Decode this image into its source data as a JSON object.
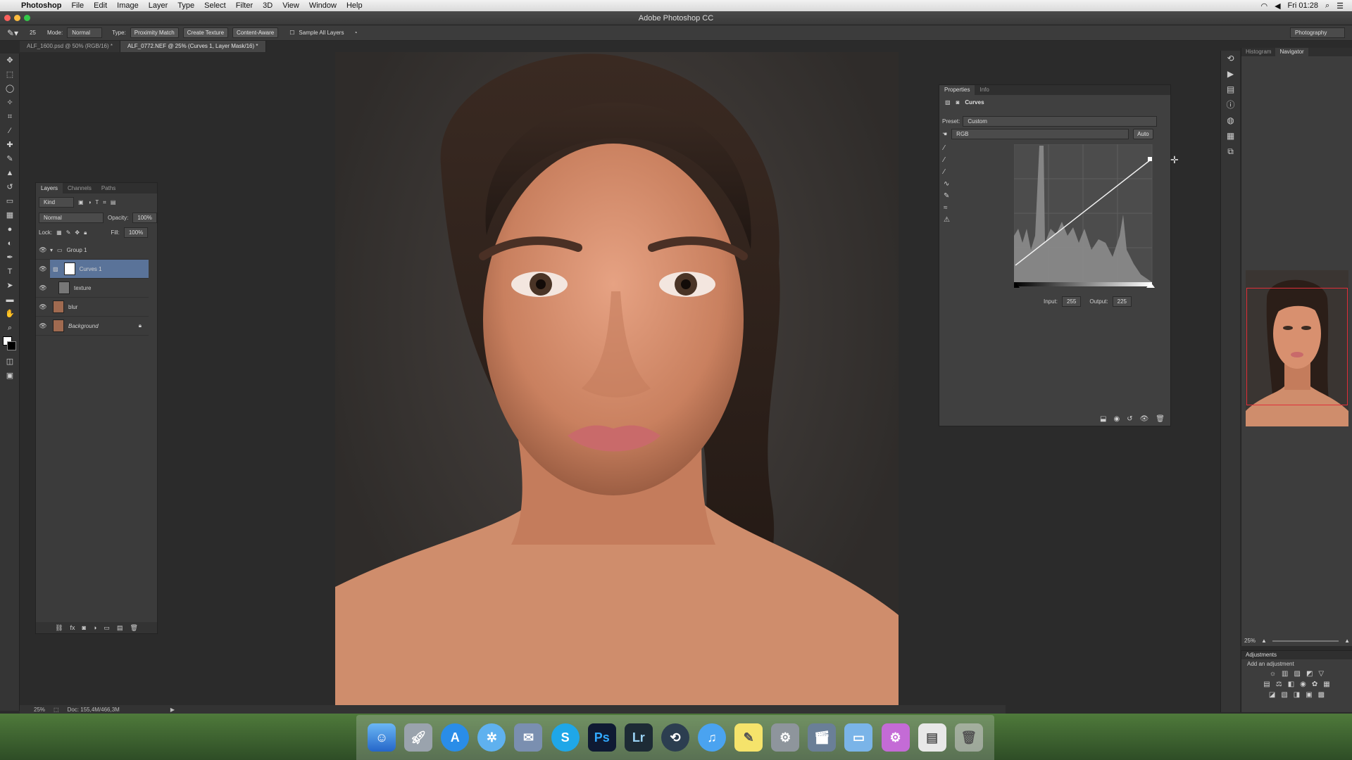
{
  "menubar": {
    "app": "Photoshop",
    "items": [
      "File",
      "Edit",
      "Image",
      "Layer",
      "Type",
      "Select",
      "Filter",
      "3D",
      "View",
      "Window",
      "Help"
    ],
    "clock": "Fri 01:28"
  },
  "window": {
    "title": "Adobe Photoshop CC"
  },
  "options": {
    "mode_label": "Mode:",
    "mode_value": "Normal",
    "type_label": "Type:",
    "type_buttons": [
      "Proximity Match",
      "Create Texture",
      "Content-Aware"
    ],
    "sample_all": "Sample All Layers",
    "workspace": "Photography",
    "brush_size": "25"
  },
  "tabs": [
    {
      "label": "ALF_1600.psd @ 50% (RGB/16) *",
      "active": false
    },
    {
      "label": "ALF_0772.NEF @ 25% (Curves 1, Layer Mask/16) *",
      "active": true
    }
  ],
  "layers_panel": {
    "tabs": [
      "Layers",
      "Channels",
      "Paths"
    ],
    "kind": "Kind",
    "blend_mode": "Normal",
    "opacity_label": "Opacity:",
    "opacity": "100%",
    "lock_label": "Lock:",
    "fill_label": "Fill:",
    "fill": "100%",
    "layers": [
      {
        "name": "Group 1"
      },
      {
        "name": "Curves 1"
      },
      {
        "name": "texture"
      },
      {
        "name": "blur"
      },
      {
        "name": "Background"
      }
    ]
  },
  "properties": {
    "tabs": [
      "Properties",
      "Info"
    ],
    "title": "Curves",
    "preset_label": "Preset:",
    "preset": "Custom",
    "channel": "RGB",
    "auto": "Auto",
    "input_label": "Input:",
    "input": "255",
    "output_label": "Output:",
    "output": "225"
  },
  "navigator": {
    "tabs": [
      "Histogram",
      "Navigator"
    ],
    "zoom": "25%"
  },
  "adjustments": {
    "title": "Adjustments",
    "subtitle": "Add an adjustment"
  },
  "status": {
    "zoom": "25%",
    "doc": "Doc: 155,4M/466,3M"
  },
  "colors": {
    "selection": "#5a7399",
    "panel": "#3b3b3b",
    "accent_red": "#e0303a"
  }
}
